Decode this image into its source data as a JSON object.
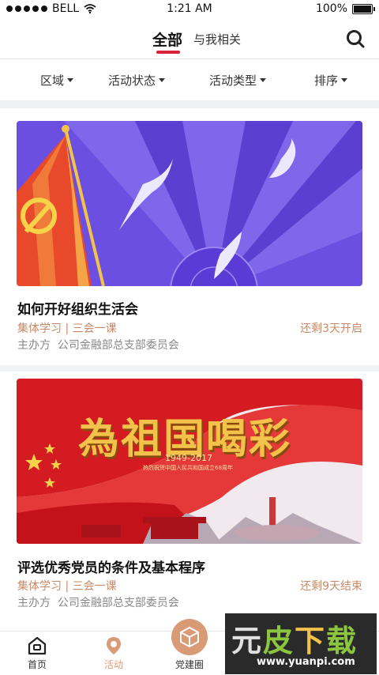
{
  "status_bar": {
    "carrier": "BELL",
    "time": "1:21 AM",
    "battery": "100%"
  },
  "top_nav": {
    "tabs": [
      {
        "label": "全部",
        "active": true
      },
      {
        "label": "与我相关",
        "active": false
      }
    ]
  },
  "filters": [
    "区域",
    "活动状态",
    "活动类型",
    "排序"
  ],
  "activities": [
    {
      "title": "如何开好组织生活会",
      "tags": "集体学习 | 三会一课",
      "status": "还剩3天开启",
      "organizer_label": "主办方",
      "organizer": "公司金融部总支部委员会"
    },
    {
      "title": "评选优秀党员的条件及基本程序",
      "tags": "集体学习 | 三会一课",
      "status": "还剩9天结束",
      "organizer_label": "主办方",
      "organizer": "公司金融部总支部委员会",
      "banner": {
        "headline": "為祖国喝彩",
        "year": "1949-2017",
        "subtitle": "热烈祝贺中国人民共和国成立68周年"
      }
    }
  ],
  "tab_bar": [
    {
      "label": "首页",
      "icon": "home-icon"
    },
    {
      "label": "活动",
      "icon": "location-pin-icon",
      "active": true
    },
    {
      "label": "党建圈",
      "icon": "cube-icon"
    }
  ],
  "watermark": {
    "text": "元皮下载",
    "url": "www.yuanpi.com"
  },
  "colors": {
    "accent_red": "#d9223a",
    "tag_brown": "#c78a68",
    "active_tab": "#d99a76"
  }
}
